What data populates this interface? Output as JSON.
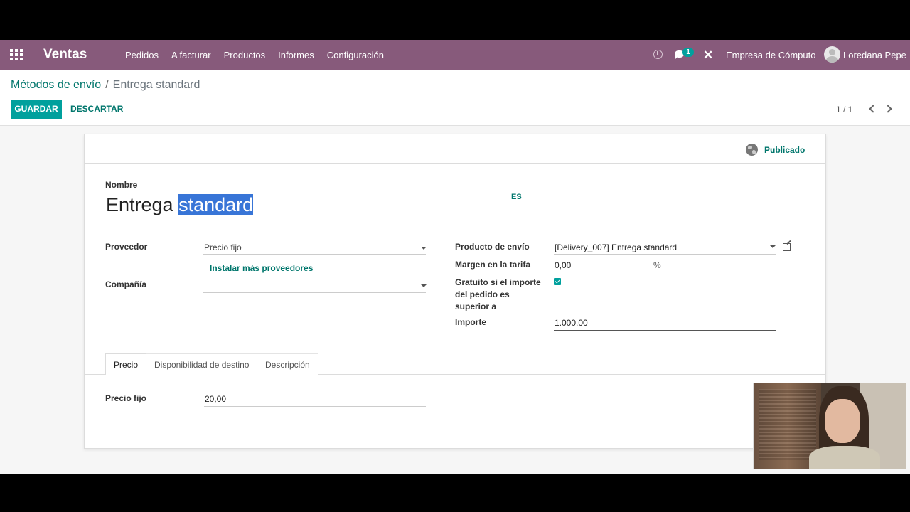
{
  "navbar": {
    "app_name": "Ventas",
    "menu": [
      "Pedidos",
      "A facturar",
      "Productos",
      "Informes",
      "Configuración"
    ],
    "message_count": "1",
    "company": "Empresa de Cómputo",
    "user": "Loredana Pepe"
  },
  "breadcrumb": {
    "parent": "Métodos de envío",
    "separator": "/",
    "current": "Entrega standard"
  },
  "actions": {
    "save": "GUARDAR",
    "discard": "DESCARTAR"
  },
  "pager": {
    "value": "1 / 1"
  },
  "form": {
    "published_label": "Publicado",
    "name_label": "Nombre",
    "name_value_plain": "Entrega ",
    "name_value_selected": "standard",
    "lang": "ES",
    "provider_label": "Proveedor",
    "provider_value": "Precio fijo",
    "install_more": "Instalar más proveedores",
    "company_label": "Compañía",
    "company_value": "",
    "delivery_product_label": "Producto de envío",
    "delivery_product_value": "[Delivery_007] Entrega standard",
    "margin_label": "Margen en la tarifa",
    "margin_value": "0,00",
    "margin_unit": "%",
    "free_label": "Gratuito si el importe del pedido es superior a",
    "free_checked": true,
    "amount_label": "Importe",
    "amount_value": "1.000,00"
  },
  "tabs": [
    "Precio",
    "Disponibilidad de destino",
    "Descripción"
  ],
  "price_tab": {
    "fixed_price_label": "Precio fijo",
    "fixed_price_value": "20,00"
  }
}
